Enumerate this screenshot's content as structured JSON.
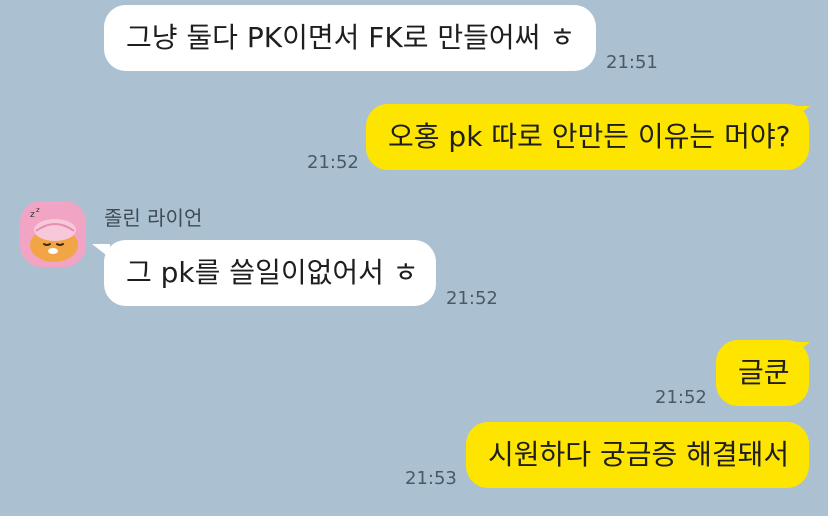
{
  "colors": {
    "background": "#abc1d1",
    "incoming_bubble": "#ffffff",
    "outgoing_bubble": "#fee500",
    "avatar_bg": "#f2a4c4"
  },
  "messages": [
    {
      "direction": "incoming",
      "text": "그냥 둘다 PK이면서 FK로 만들어써 ㅎ",
      "time": "21:51"
    },
    {
      "direction": "outgoing",
      "text": "오홍 pk 따로 안만든 이유는 머야?",
      "time": "21:52"
    },
    {
      "direction": "incoming",
      "sender": "졸린 라이언",
      "avatar_icon": "sleepy-lion-icon",
      "text": "그 pk를 쓸일이없어서 ㅎ",
      "time": "21:52"
    },
    {
      "direction": "outgoing",
      "text": "글쿤",
      "time": "21:52"
    },
    {
      "direction": "outgoing",
      "text": "시원하다 궁금증 해결돼서",
      "time": "21:53"
    }
  ]
}
